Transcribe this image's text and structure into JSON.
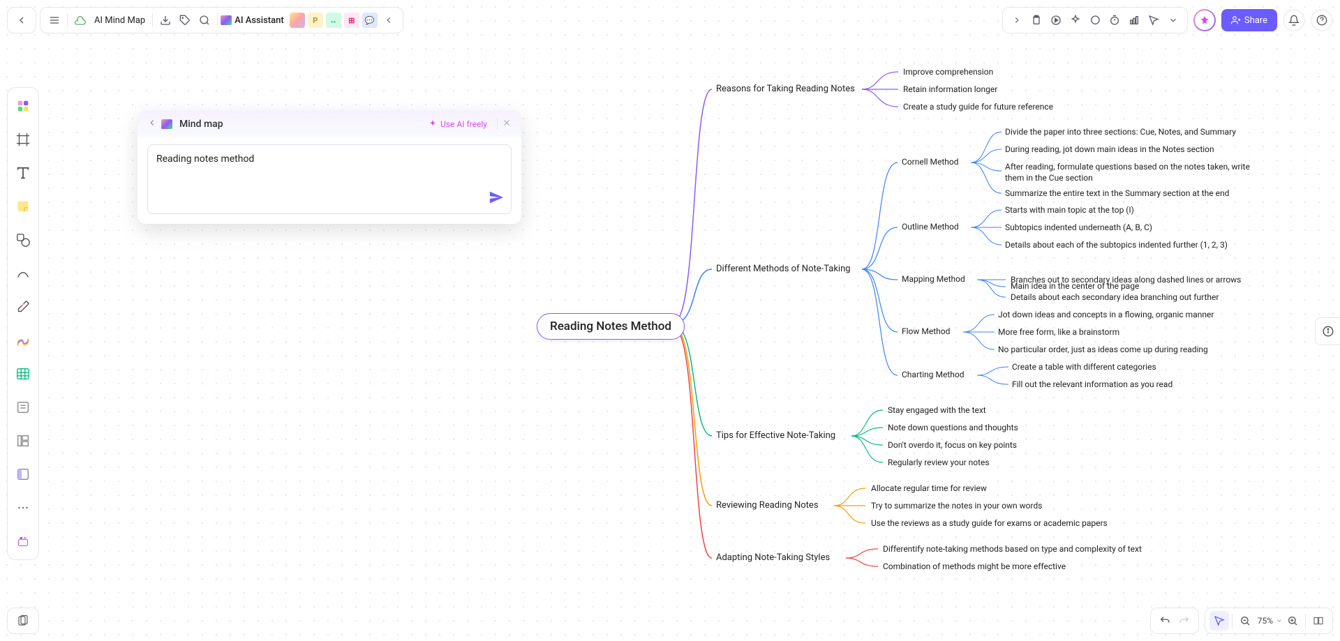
{
  "topbar": {
    "doc_title": "AI Mind Map",
    "ai_assistant": "AI Assistant"
  },
  "share_label": "Share",
  "ai_dialog": {
    "title": "Mind map",
    "use_free": "Use AI freely",
    "input_text": "Reading notes method"
  },
  "zoom": "75%",
  "mindmap": {
    "root": "Reading Notes Method",
    "branches": [
      {
        "label": "Reasons for Taking Reading Notes",
        "leaves": [
          "Improve comprehension",
          "Retain information longer",
          "Create a study guide for future reference"
        ]
      },
      {
        "label": "Different Methods of Note-Taking",
        "subbranches": [
          {
            "label": "Cornell Method",
            "leaves": [
              "Divide the paper into three sections: Cue, Notes, and Summary",
              "During reading, jot down main ideas in the Notes section",
              "After reading, formulate questions based on the notes taken, write them in the Cue section",
              "Summarize the entire text in the Summary section at the end"
            ]
          },
          {
            "label": "Outline Method",
            "leaves": [
              "Starts with main topic at the top (I)",
              "Subtopics indented underneath (A, B, C)",
              "Details about each of the subtopics indented further (1, 2, 3)"
            ]
          },
          {
            "label": "Mapping Method",
            "leaves": [
              "Main idea in the center of the page",
              "Branches out to secondary ideas along dashed lines or arrows",
              "Details about each secondary idea branching out further"
            ]
          },
          {
            "label": "Flow Method",
            "leaves": [
              "Jot down ideas and concepts in a flowing, organic manner",
              "More free form, like a brainstorm",
              "No particular order, just as ideas come up during reading"
            ]
          },
          {
            "label": "Charting Method",
            "leaves": [
              "Create a table with different categories",
              "Fill out the relevant information as you read"
            ]
          }
        ]
      },
      {
        "label": "Tips for Effective Note-Taking",
        "leaves": [
          "Stay engaged with the text",
          "Note down questions and thoughts",
          "Don't overdo it, focus on key points",
          "Regularly review your notes"
        ]
      },
      {
        "label": "Reviewing Reading Notes",
        "leaves": [
          "Allocate regular time for review",
          "Try to summarize the notes in your own words",
          "Use the reviews as a study guide for exams or academic papers"
        ]
      },
      {
        "label": "Adapting Note-Taking Styles",
        "leaves": [
          "Differentify note-taking methods based on type and complexity of text",
          "Combination of methods might be more effective"
        ]
      }
    ]
  },
  "colors": {
    "purple": "#8b5cf6",
    "blue": "#3b82f6",
    "green": "#10b981",
    "orange": "#f59e0b",
    "red": "#ef4444"
  }
}
